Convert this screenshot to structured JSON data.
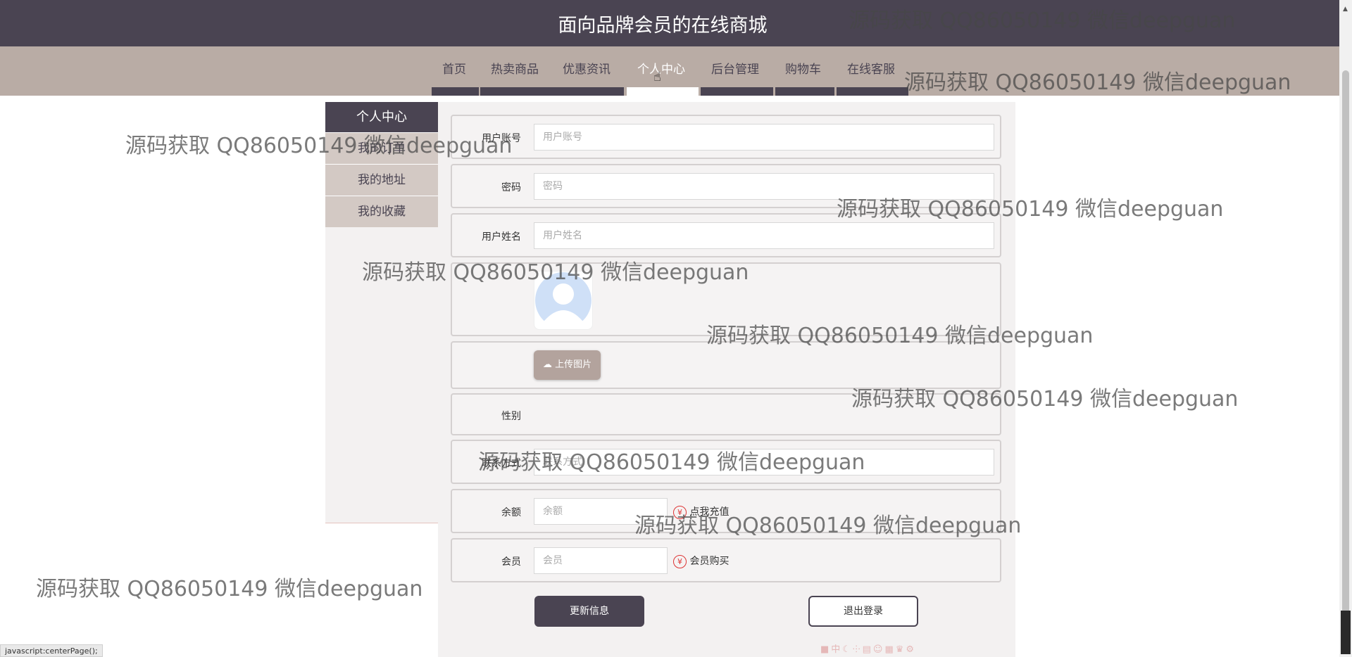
{
  "header": {
    "title": "面向品牌会员的在线商城"
  },
  "nav": {
    "items": [
      "首页",
      "热卖商品",
      "优惠资讯",
      "个人中心",
      "后台管理",
      "购物车",
      "在线客服"
    ],
    "active": "个人中心"
  },
  "sidebar": {
    "title": "个人中心",
    "items": [
      "我的订单",
      "我的地址",
      "我的收藏"
    ]
  },
  "form": {
    "account": {
      "label": "用户账号",
      "placeholder": "用户账号"
    },
    "password": {
      "label": "密码",
      "placeholder": "密码"
    },
    "name": {
      "label": "用户姓名",
      "placeholder": "用户姓名"
    },
    "upload_label": "上传图片",
    "gender": {
      "label": "性别"
    },
    "contact": {
      "label": "联系方式",
      "placeholder": "联系方式"
    },
    "balance": {
      "label": "余额",
      "placeholder": "余额",
      "action": "点我充值"
    },
    "member": {
      "label": "会员",
      "placeholder": "会员",
      "action": "会员购买"
    }
  },
  "buttons": {
    "update": "更新信息",
    "logout": "退出登录"
  },
  "watermark": "源码获取 QQ86050149 微信deepguan",
  "statusbar": "javascript:centerPage();",
  "icons": {
    "upload": "cloud-upload-icon",
    "currency": "yen-icon",
    "avatar": "user-avatar-icon"
  },
  "colors": {
    "primary": "#4a4452",
    "nav_bg": "#b9aca5",
    "sidebar_item": "#d3c9c4",
    "upload": "#b3a39d"
  }
}
